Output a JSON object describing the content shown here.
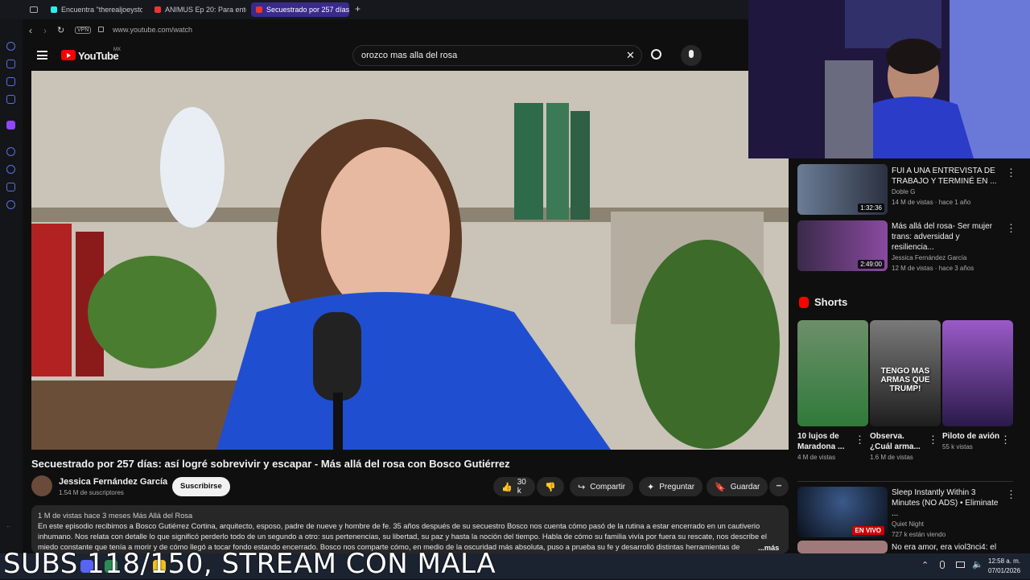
{
  "browser": {
    "tabs": [
      {
        "label": "Encuentra \"therealjoeystor"
      },
      {
        "label": "ANIMUS Ep 20: Para enter"
      },
      {
        "label": "Secuestrado por 257 días:"
      }
    ],
    "add_tab": "+",
    "vpn_badge": "VPN",
    "url": "www.youtube.com/watch"
  },
  "youtube": {
    "logo_text": "YouTube",
    "region": "MX",
    "search_value": "orozco mas alla del rosa",
    "clear_glyph": "✕"
  },
  "video": {
    "title": "Secuestrado por 257 días: así logré sobrevivir y escapar - Más allá del rosa con Bosco Gutiérrez",
    "channel": "Jessica Fernández García",
    "subscribers": "1.54 M de suscriptores",
    "subscribe_label": "Suscribirse",
    "likes": "30 k",
    "share_label": "Compartir",
    "ask_label": "Preguntar",
    "save_label": "Guardar",
    "more_glyph": "•••",
    "desc_meta": "1 M de vistas  hace 3 meses  Más Allá del Rosa",
    "desc_text": "En este episodio recibimos a Bosco Gutiérrez Cortina, arquitecto, esposo, padre de nueve y hombre de fe. 35 años después de su secuestro Bosco nos cuenta cómo pasó de la rutina a estar encerrado en un cautiverio inhumano. Nos relata con detalle lo que significó perderlo todo de un segundo a otro: sus pertenencias, su libertad, su paz y hasta la noción del tiempo. Habla de cómo su familia vivía por fuera su rescate, nos describe el miedo constante que tenía a morir y de cómo llegó a tocar fondo estando encerrado. Bosco nos comparte cómo, en medio de la oscuridad más absoluta, puso a prueba su fe y desarrolló distintas herramientas de supervivencia",
    "desc_more": "...más"
  },
  "related": [
    {
      "title": "FUI A UNA ENTREVISTA DE TRABAJO Y TERMINÉ EN ...",
      "channel": "Doble G",
      "stats": "14 M de vistas · hace 1 año",
      "duration": "1:32:36"
    },
    {
      "title": "Más allá del rosa- Ser mujer trans: adversidad y resiliencia...",
      "channel": "Jessica Fernández García",
      "stats": "12 M de vistas · hace 3 años",
      "duration": "2:49:00"
    }
  ],
  "shorts": {
    "heading": "Shorts",
    "items": [
      {
        "title": "10 lujos de Maradona ...",
        "views": "4 M de vistas"
      },
      {
        "title": "Observa. ¿Cuál arma...",
        "views": "1.6 M de vistas",
        "overlay": "TENGO MAS ARMAS QUE TRUMP!"
      },
      {
        "title": "Piloto de avión",
        "views": "55 k vistas"
      }
    ]
  },
  "more_related": [
    {
      "title": "Sleep Instantly Within 3 Minutes (NO ADS) • Eliminate ...",
      "channel": "Quiet Night",
      "stats": "727 k están viendo",
      "live_badge": "EN VIVO"
    },
    {
      "title": "No era amor, era viol3nci4: el"
    }
  ],
  "stream_overlay": "SUBS 118/150, STREAM CON MALA",
  "taskbar": {
    "time": "12:58 a. m.",
    "date": "07/01/2026"
  },
  "colors": {
    "accent": "#3a2a8c",
    "youtube_red": "#ff0000",
    "live": "#cc0000"
  }
}
